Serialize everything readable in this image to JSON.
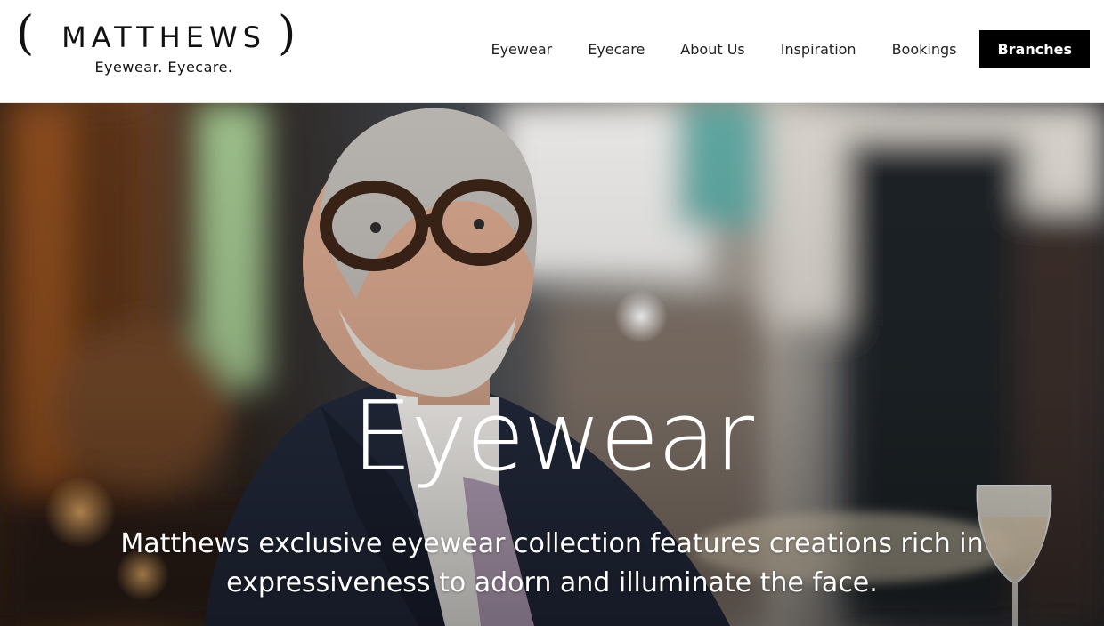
{
  "brand": {
    "name": "MATTHEWS",
    "tagline": "Eyewear. Eyecare."
  },
  "nav": {
    "items": [
      {
        "label": "Eyewear"
      },
      {
        "label": "Eyecare"
      },
      {
        "label": "About Us"
      },
      {
        "label": "Inspiration"
      },
      {
        "label": "Bookings"
      }
    ],
    "cta_label": "Branches"
  },
  "hero": {
    "title": "Eyewear",
    "subtitle": "Matthews exclusive eyewear collection features creations rich in expressiveness to adorn and illuminate the face."
  },
  "colors": {
    "header_bg": "#ffffff",
    "cta_bg": "#000000",
    "cta_text": "#ffffff",
    "hero_text": "#ffffff"
  }
}
